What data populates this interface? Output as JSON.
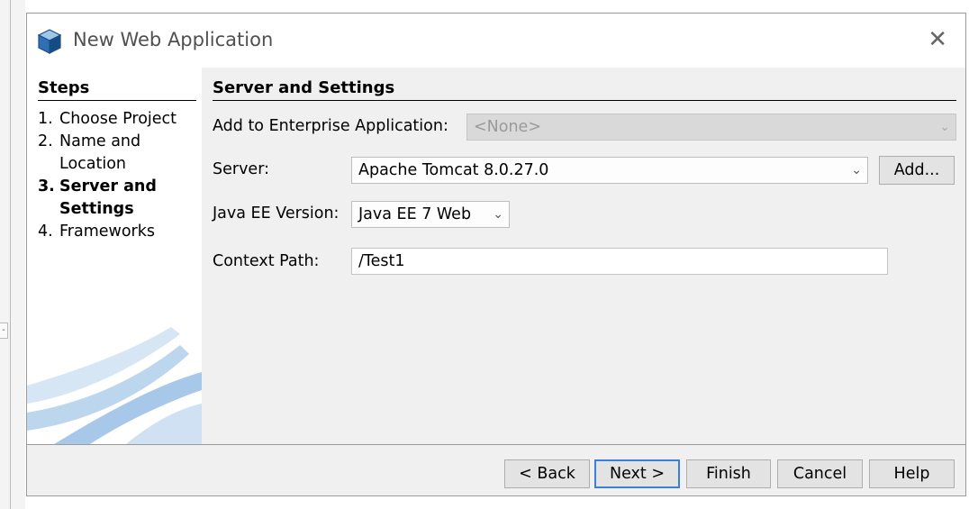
{
  "window": {
    "title": "New Web Application",
    "close_glyph": "✕"
  },
  "steps": {
    "heading": "Steps",
    "items": [
      {
        "num": "1.",
        "label": "Choose Project"
      },
      {
        "num": "2.",
        "label": "Name and Location"
      },
      {
        "num": "3.",
        "label": "Server and Settings",
        "current": true
      },
      {
        "num": "4.",
        "label": "Frameworks"
      }
    ]
  },
  "panel": {
    "heading": "Server and Settings",
    "enterprise": {
      "label": "Add to Enterprise Application:",
      "value": "<None>",
      "enabled": false
    },
    "server": {
      "label": "Server:",
      "value": "Apache Tomcat 8.0.27.0",
      "add_label": "Add..."
    },
    "javaee": {
      "label": "Java EE Version:",
      "value": "Java EE 7 Web"
    },
    "context": {
      "label": "Context Path:",
      "value": "/Test1"
    }
  },
  "footer": {
    "back": "< Back",
    "next": "Next >",
    "finish": "Finish",
    "cancel": "Cancel",
    "help": "Help"
  },
  "icons": {
    "app": "netbeans-cube-icon",
    "dropdown": "chevron-down-icon",
    "close": "close-icon"
  },
  "colors": {
    "accent_focus": "#3c7fd6",
    "panel_bg": "#f0f0f0",
    "disabled_bg": "#d9d9d9"
  }
}
